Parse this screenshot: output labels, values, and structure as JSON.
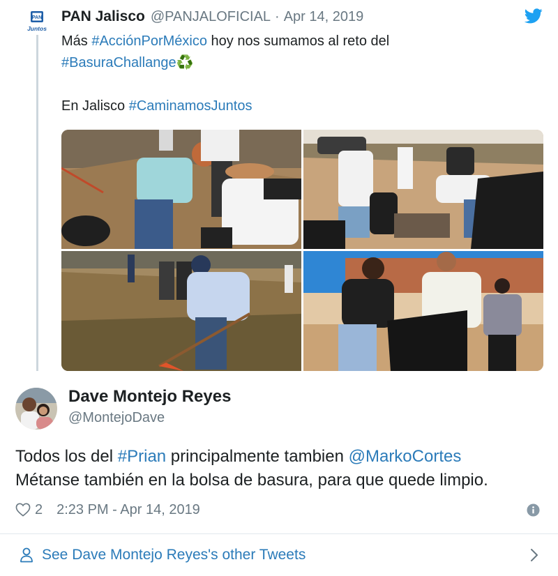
{
  "parent": {
    "name": "PAN Jalisco",
    "handle": "@PANJALOFICIAL",
    "separator": "·",
    "date": "Apr 14, 2019",
    "logo_icon": "pan-jalisco-logo",
    "logo_text_top": "PAN",
    "logo_text_bottom": "Juntos",
    "text": {
      "line1_prefix": "Más ",
      "line1_hashtag": "#AcciónPorMéxico",
      "line1_suffix": " hoy nos sumamos al reto del",
      "line2_hashtag": "#BasuraChallange",
      "line2_emoji": "♻️",
      "line3_prefix": "En Jalisco ",
      "line3_hashtag": "#CaminamosJuntos"
    }
  },
  "tweet": {
    "author_name": "Dave Montejo Reyes",
    "author_handle": "@MontejoDave",
    "text": {
      "line1_prefix": "Todos los del ",
      "line1_hashtag": "#Prian",
      "line1_middle": " principalmente tambien ",
      "line1_mention": "@MarkoCortes",
      "line2": "Métanse también en la bolsa de basura, para que quede limpio."
    },
    "likes": "2",
    "timestamp": "2:23 PM - Apr 14, 2019"
  },
  "footer": {
    "see_more": "See Dave Montejo Reyes's other Tweets"
  },
  "colors": {
    "link": "#2b7bb9",
    "muted": "#697882",
    "text": "#1c2022",
    "divider": "#e1e8ed"
  },
  "icons": [
    "twitter-bird-icon",
    "heart-icon",
    "info-icon",
    "person-icon",
    "chevron-right-icon"
  ]
}
